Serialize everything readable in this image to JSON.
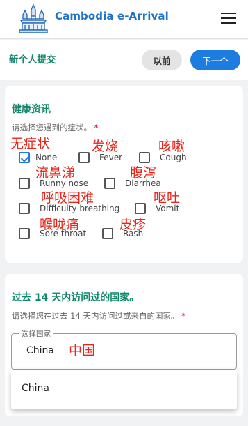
{
  "header": {
    "app_title": "Cambodia e-Arrival",
    "logo": "angkor-wat-logo",
    "menu_icon": "hamburger-menu-icon"
  },
  "nav": {
    "title": "新个人提交",
    "prev_label": "以前",
    "next_label": "下一个"
  },
  "health": {
    "title": "健康资讯",
    "hint": "请选择您遇到的症状。",
    "required_mark": "*",
    "symptoms": [
      {
        "label": "None",
        "checked": true,
        "note": "无症状"
      },
      {
        "label": "Fever",
        "checked": false,
        "note": "发烧"
      },
      {
        "label": "Cough",
        "checked": false,
        "note": "咳嗽"
      },
      {
        "label": "Runny nose",
        "checked": false,
        "note": "流鼻涕"
      },
      {
        "label": "Diarrhea",
        "checked": false,
        "note": "腹泻"
      },
      {
        "label": "Difficulty breathing",
        "checked": false,
        "note": "呼吸困难"
      },
      {
        "label": "Vomit",
        "checked": false,
        "note": "呕吐"
      },
      {
        "label": "Sore throat",
        "checked": false,
        "note": "喉咙痛"
      },
      {
        "label": "Rash",
        "checked": false,
        "note": "皮疹"
      }
    ]
  },
  "countries": {
    "title": "过去 14 天内访问过的国家。",
    "hint": "请选择您在过去 14 天内访问过或来自的国家。",
    "required_mark": "*",
    "field_label": "选择国家",
    "field_value": "China",
    "field_note": "中国",
    "dropdown_options": [
      "China"
    ]
  },
  "colors": {
    "accent_blue": "#1d7ce0",
    "title_green": "#13876a",
    "note_red": "#e8271c"
  }
}
